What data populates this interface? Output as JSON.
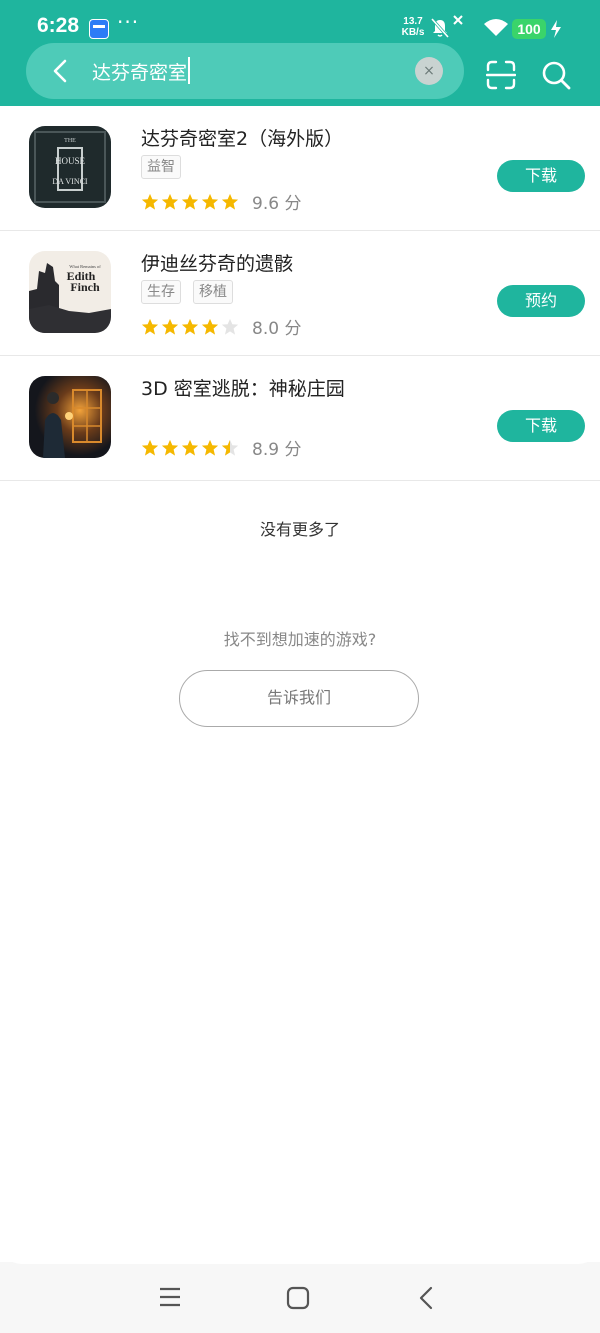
{
  "status_bar": {
    "time": "6:28",
    "net_speed_value": "13.7",
    "net_speed_unit": "KB/s",
    "battery": "100",
    "icons": [
      "notification-app-icon",
      "more-dots-icon",
      "mute-icon",
      "wifi-icon",
      "charging-bolt-icon"
    ]
  },
  "search": {
    "query": "达芬奇密室",
    "clear_symbol": "×"
  },
  "results": [
    {
      "name": "达芬奇密室2（海外版）",
      "tags": [
        "益智"
      ],
      "rating_stars": 5,
      "score": "9.6 分",
      "action": "下载",
      "icon_theme": "house-of-davinci"
    },
    {
      "name": "伊迪丝芬奇的遗骸",
      "tags": [
        "生存",
        "移植"
      ],
      "rating_stars": 4,
      "score": "8.0 分",
      "action": "预约",
      "icon_theme": "edith-finch"
    },
    {
      "name": "3D 密室逃脱：神秘庄园",
      "tags": [],
      "rating_stars": 4.5,
      "score": "8.9 分",
      "action": "下载",
      "icon_theme": "mystery-manor"
    }
  ],
  "icon_text": {
    "davinci_line1": "THE",
    "davinci_line2": "HOUSE",
    "davinci_line3": "DA VINCI",
    "finch_small": "What Remains of",
    "finch_title1": "Edith",
    "finch_title2": "Finch"
  },
  "footer": {
    "no_more": "没有更多了",
    "cant_find": "找不到想加速的游戏?",
    "tell_us": "告诉我们"
  },
  "colors": {
    "accent": "#1fb59e",
    "star": "#f5b800",
    "star_empty": "#e4e4e4"
  }
}
